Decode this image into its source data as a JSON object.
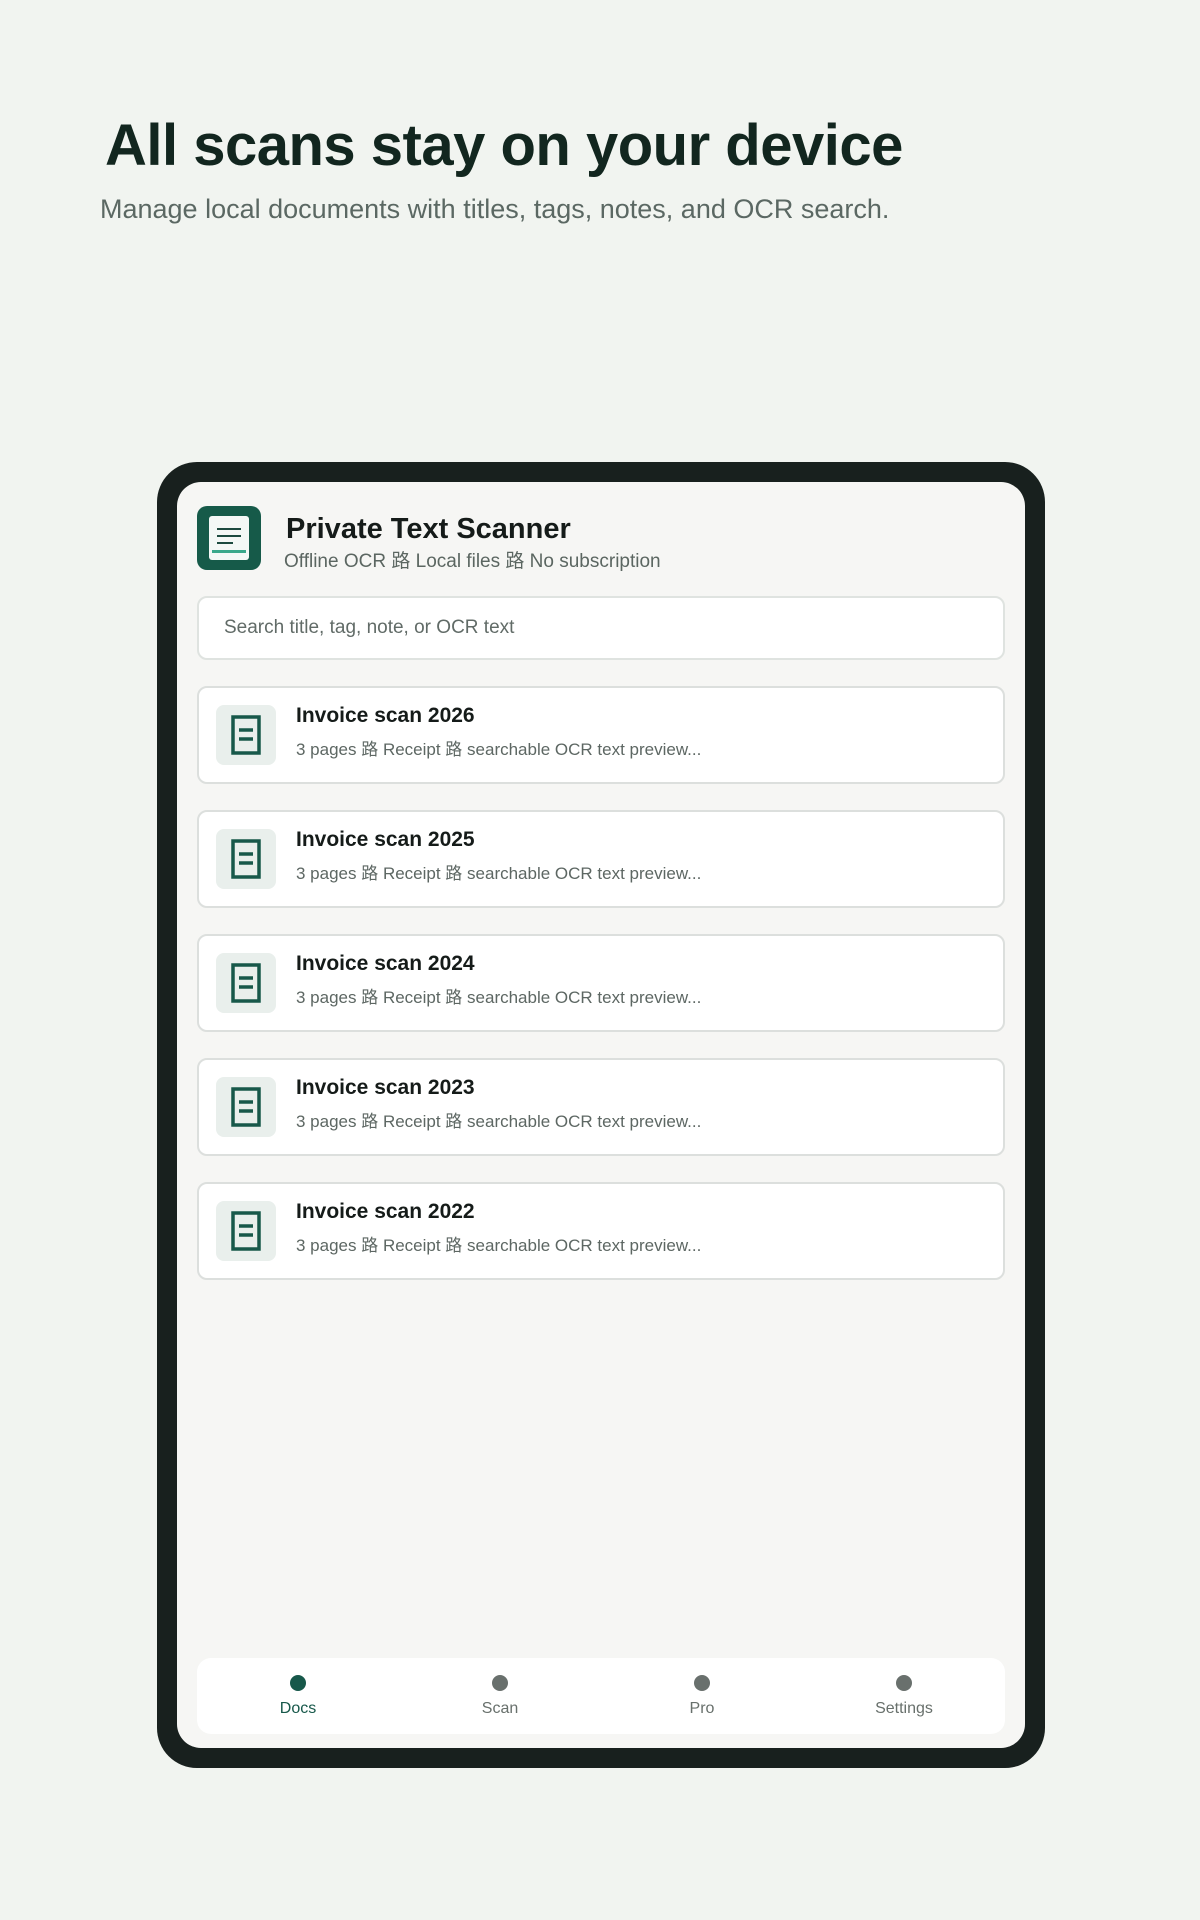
{
  "hero": {
    "title": "All scans stay on your device",
    "subtitle": "Manage local documents with titles, tags, notes, and OCR search."
  },
  "app": {
    "title": "Private Text Scanner",
    "subtitle": "Offline OCR 路 Local files 路 No subscription",
    "logo_icon": "document-lines-icon"
  },
  "search": {
    "placeholder": "Search title, tag, note, or OCR text",
    "value": ""
  },
  "documents": [
    {
      "title": "Invoice scan 2026",
      "meta": "3 pages 路 Receipt 路 searchable OCR text preview..."
    },
    {
      "title": "Invoice scan 2025",
      "meta": "3 pages 路 Receipt 路 searchable OCR text preview..."
    },
    {
      "title": "Invoice scan 2024",
      "meta": "3 pages 路 Receipt 路 searchable OCR text preview..."
    },
    {
      "title": "Invoice scan 2023",
      "meta": "3 pages 路 Receipt 路 searchable OCR text preview..."
    },
    {
      "title": "Invoice scan 2022",
      "meta": "3 pages 路 Receipt 路 searchable OCR text preview..."
    }
  ],
  "nav": {
    "items": [
      {
        "label": "Docs",
        "active": true
      },
      {
        "label": "Scan",
        "active": false
      },
      {
        "label": "Pro",
        "active": false
      },
      {
        "label": "Settings",
        "active": false
      }
    ]
  },
  "colors": {
    "background": "#f1f4f0",
    "accent": "#165a49",
    "device_frame": "#18201e",
    "screen": "#f6f6f4"
  }
}
